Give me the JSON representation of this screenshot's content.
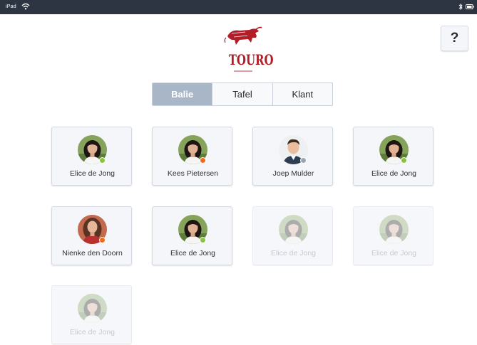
{
  "statusbar": {
    "device": "iPad",
    "wifi_icon": "wifi-icon",
    "bluetooth_icon": "bluetooth-icon",
    "battery_icon": "battery-icon"
  },
  "brand": {
    "name": "TOURO",
    "color": "#b31d27"
  },
  "help": {
    "label": "?"
  },
  "tabs": [
    {
      "label": "Balie",
      "active": true
    },
    {
      "label": "Tafel",
      "active": false
    },
    {
      "label": "Klant",
      "active": false
    }
  ],
  "colors": {
    "accent": "#a9b6c8",
    "online": "#8ac43f",
    "busy": "#f26b1d",
    "away": "#9aa6b2"
  },
  "users": [
    {
      "name": "Elice de Jong",
      "avatar": "woman",
      "status": "online",
      "enabled": true
    },
    {
      "name": "Kees Pietersen",
      "avatar": "woman",
      "status": "busy",
      "enabled": true
    },
    {
      "name": "Joep Mulder",
      "avatar": "man",
      "status": "away",
      "enabled": true
    },
    {
      "name": "Elice de Jong",
      "avatar": "woman",
      "status": "online",
      "enabled": true
    },
    {
      "name": "Nienke den Doorn",
      "avatar": "woman-red",
      "status": "busy",
      "enabled": true
    },
    {
      "name": "Elice de Jong",
      "avatar": "woman",
      "status": "online",
      "enabled": true
    },
    {
      "name": "Elice de Jong",
      "avatar": "woman",
      "status": "none",
      "enabled": false
    },
    {
      "name": "Elice de Jong",
      "avatar": "woman",
      "status": "none",
      "enabled": false
    },
    {
      "name": "Elice de Jong",
      "avatar": "woman",
      "status": "none",
      "enabled": false
    }
  ]
}
